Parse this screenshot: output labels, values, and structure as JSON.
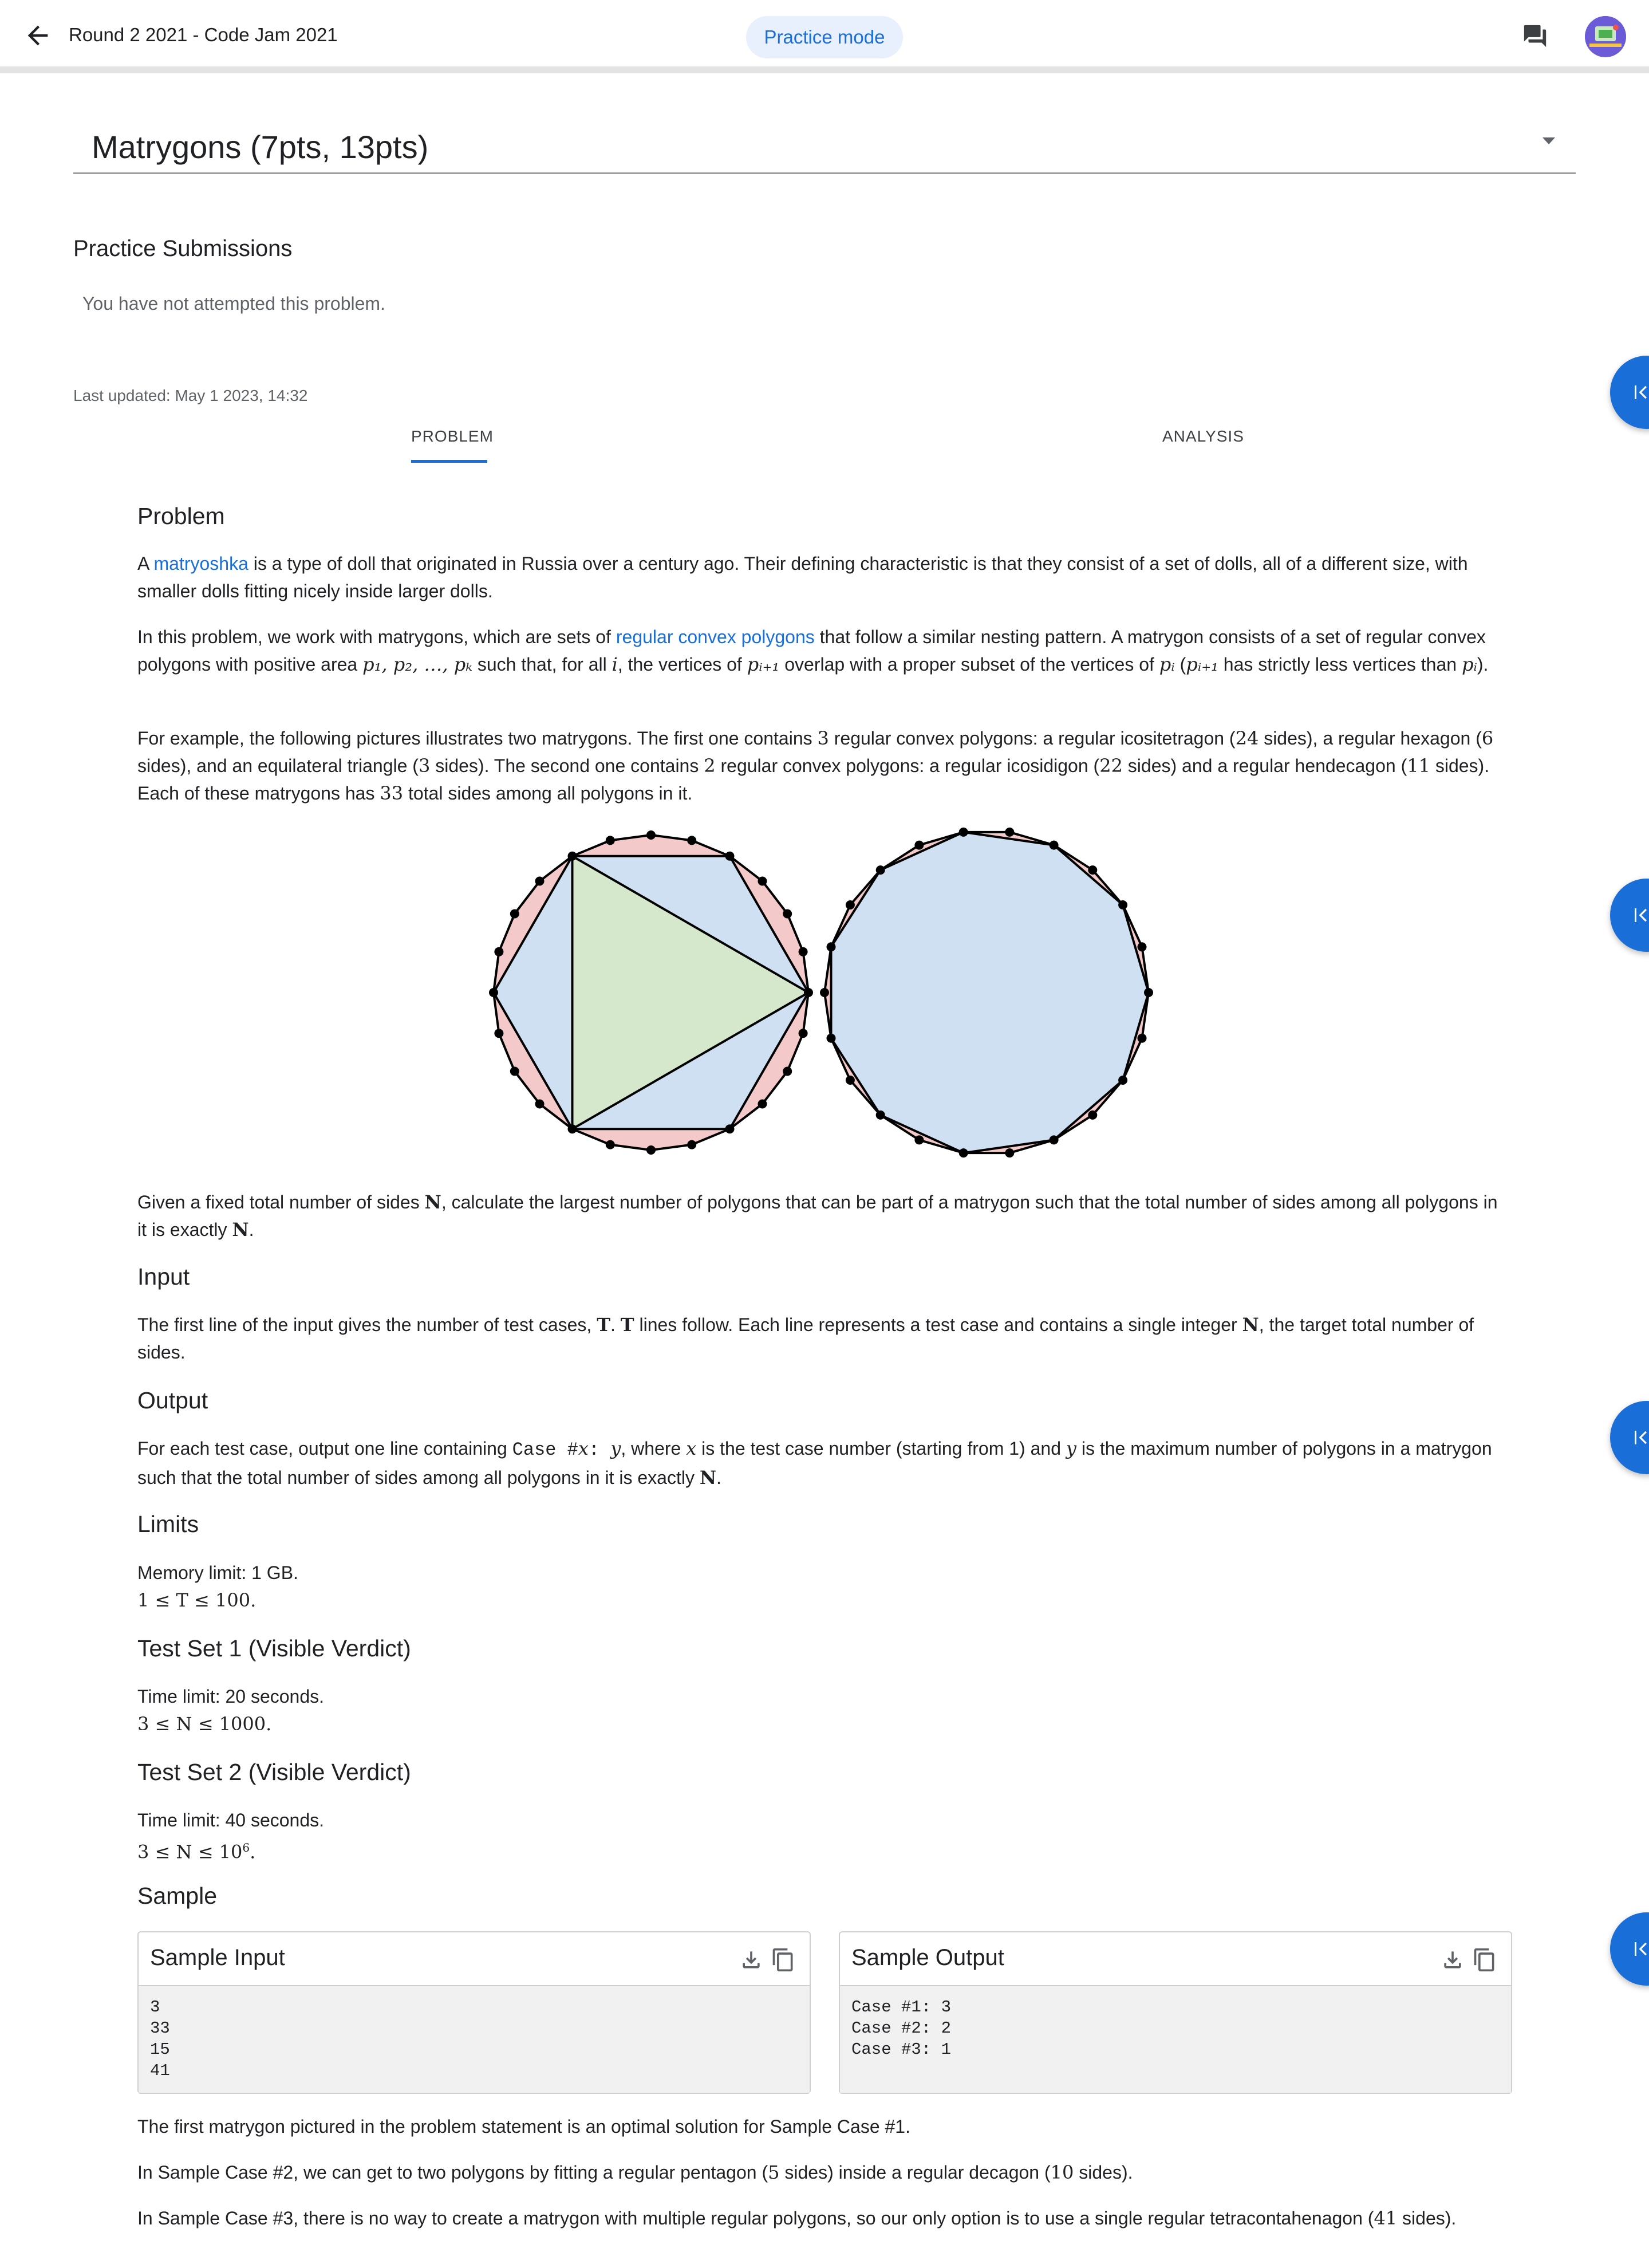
{
  "topbar": {
    "back_icon": "arrow-back-icon",
    "title": "Round 2 2021 - Code Jam 2021",
    "practice_chip": "Practice mode",
    "chat_icon": "chat-icon",
    "avatar_icon": "avatar"
  },
  "problem_select": {
    "label": "Matrygons (7pts, 13pts)"
  },
  "submissions": {
    "heading": "Practice Submissions",
    "empty_text": "You have not attempted this problem."
  },
  "last_updated": "Last updated: May 1 2023, 14:32",
  "tabs": [
    {
      "label": "PROBLEM",
      "active": true
    },
    {
      "label": "ANALYSIS",
      "active": false
    }
  ],
  "colors": {
    "accent": "#1a6ed8",
    "chip_bg": "#e7f0fc",
    "outer_fill": "#f4c9c9",
    "mid_fill": "#cfe0f3",
    "inner_fill": "#d6e8cc"
  },
  "problem": {
    "heading": "Problem",
    "p1_link": "matryoshka",
    "p1_pre": "A ",
    "p1_post": " is a type of doll that originated in Russia over a century ago. Their defining characteristic is that they consist of a set of dolls, all of a different size, with smaller dolls fitting nicely inside larger dolls.",
    "p2_pre": "In this problem, we work with matrygons, which are sets of ",
    "p2_link": "regular convex polygons",
    "p2_a": " that follow a similar nesting pattern. A matrygon consists of a set of regular convex polygons with positive area ",
    "p2_m1": "p₁, p₂, …, pₖ",
    "p2_b": " such that, for all ",
    "p2_m2": "i",
    "p2_c": ", the vertices of ",
    "p2_m3": "pᵢ₊₁",
    "p2_d": " overlap with a proper subset of the vertices of ",
    "p2_m4": "pᵢ",
    "p2_e": " (",
    "p2_m5": "pᵢ₊₁",
    "p2_f": " has strictly less vertices than ",
    "p2_m6": "pᵢ",
    "p2_g": ").",
    "p3_a": "For example, the following pictures illustrates two matrygons. The first one contains ",
    "p3_m1": "3",
    "p3_b": " regular convex polygons: a regular icositetragon (",
    "p3_m2": "24",
    "p3_c": " sides), a regular hexagon (",
    "p3_m3": "6",
    "p3_d": " sides), and an equilateral triangle (",
    "p3_m4": "3",
    "p3_e": " sides). The second one contains ",
    "p3_m5": "2",
    "p3_f": " regular convex polygons: a regular icosidigon (",
    "p3_m6": "22",
    "p3_g": " sides) and a regular hendecagon (",
    "p3_m7": "11",
    "p3_h": " sides). Each of these matrygons has ",
    "p3_m8": "33",
    "p3_i": " total sides among all polygons in it.",
    "p4_a": "Given a fixed total number of sides ",
    "p4_m1": "N",
    "p4_b": ", calculate the largest number of polygons that can be part of a matrygon such that the total number of sides among all polygons in it is exactly ",
    "p4_m2": "N",
    "p4_c": "."
  },
  "input": {
    "heading": "Input",
    "a": "The first line of the input gives the number of test cases, ",
    "m1": "T",
    "b": ". ",
    "m2": "T",
    "c": " lines follow. Each line represents a test case and contains a single integer ",
    "m3": "N",
    "d": ", the target total number of sides."
  },
  "output": {
    "heading": "Output",
    "a": "For each test case, output one line containing ",
    "code": "Case #",
    "m1": "x",
    "code2": ": ",
    "m2": "y",
    "b": ", where ",
    "m3": "x",
    "c": " is the test case number (starting from 1) and ",
    "m4": "y",
    "d": " is the maximum number of polygons in a matrygon such that the total number of sides among all polygons in it is exactly ",
    "m5": "N",
    "e": "."
  },
  "limits": {
    "heading": "Limits",
    "memory": "Memory limit: 1 GB.",
    "t_range": "1 ≤ T ≤ 100."
  },
  "test_set_1": {
    "heading": "Test Set 1 (Visible Verdict)",
    "time": "Time limit: 20 seconds.",
    "range": "3 ≤ N ≤ 1000."
  },
  "test_set_2": {
    "heading": "Test Set 2 (Visible Verdict)",
    "time": "Time limit: 40 seconds.",
    "range_pre": "3 ≤ N ≤ 10",
    "range_exp": "6",
    "range_post": "."
  },
  "sample": {
    "heading": "Sample",
    "input_title": "Sample Input",
    "output_title": "Sample Output",
    "input_lines": [
      "3",
      "33",
      "15",
      "41"
    ],
    "output_lines": [
      "Case #1: 3",
      "Case #2: 2",
      "Case #3: 1"
    ],
    "note1": "The first matrygon pictured in the problem statement is an optimal solution for Sample Case #1.",
    "note2_a": "In Sample Case #2, we can get to two polygons by fitting a regular pentagon (",
    "note2_m1": "5",
    "note2_b": " sides) inside a regular decagon (",
    "note2_m2": "10",
    "note2_c": " sides).",
    "note3_a": "In Sample Case #3, there is no way to create a matrygon with multiple regular polygons, so our only option is to use a single regular tetracontahenagon (",
    "note3_m1": "41",
    "note3_b": " sides)."
  },
  "side_fab_icon": "collapse-left-icon"
}
